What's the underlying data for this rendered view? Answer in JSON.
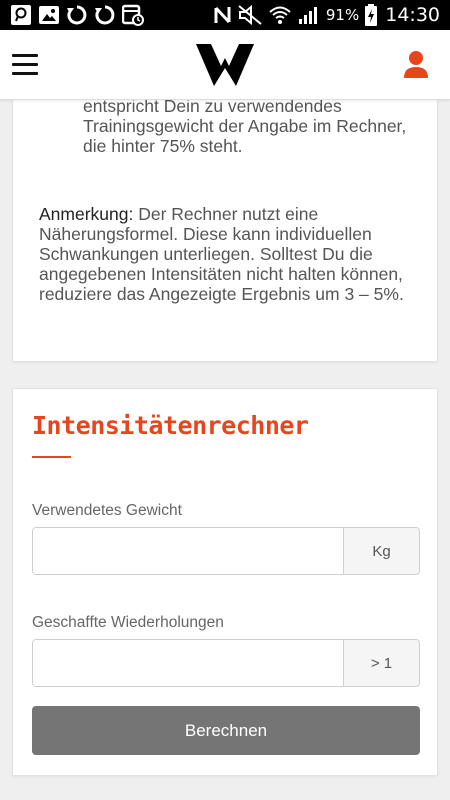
{
  "status_bar": {
    "battery_percent": "91%",
    "time": "14:30",
    "icons": [
      "search-icon",
      "image-icon",
      "sync-icon",
      "sync-icon",
      "calendar-clock-icon",
      "nfc-icon",
      "mute-icon",
      "wifi-icon",
      "signal-icon",
      "battery-charging-icon"
    ]
  },
  "header": {
    "menu_icon": "hamburger-menu-icon",
    "logo_icon": "w-logo-icon",
    "user_icon": "user-icon"
  },
  "info": {
    "paragraph1": "entspricht Dein zu verwendendes Trainingsgewicht der Angabe im Rechner, die hinter 75% steht.",
    "note_label": "Anmerkung:",
    "note_text": " Der Rechner nutzt eine Näherungsformel. Diese kann individuellen Schwankungen unterliegen. Solltest Du die angegebenen Intensitäten nicht halten können, reduziere das Angezeigte Ergebnis um 3 – 5%."
  },
  "calculator": {
    "title": "Intensitätenrechner",
    "weight_label": "Verwendetes Gewicht",
    "weight_value": "",
    "weight_placeholder": "",
    "weight_unit": "Kg",
    "reps_label": "Geschaffte Wiederholungen",
    "reps_value": "",
    "reps_placeholder": "",
    "reps_unit": "> 1",
    "button_label": "Berechnen"
  },
  "colors": {
    "accent": "#e8451e",
    "button": "#757575",
    "background": "#efefef"
  }
}
